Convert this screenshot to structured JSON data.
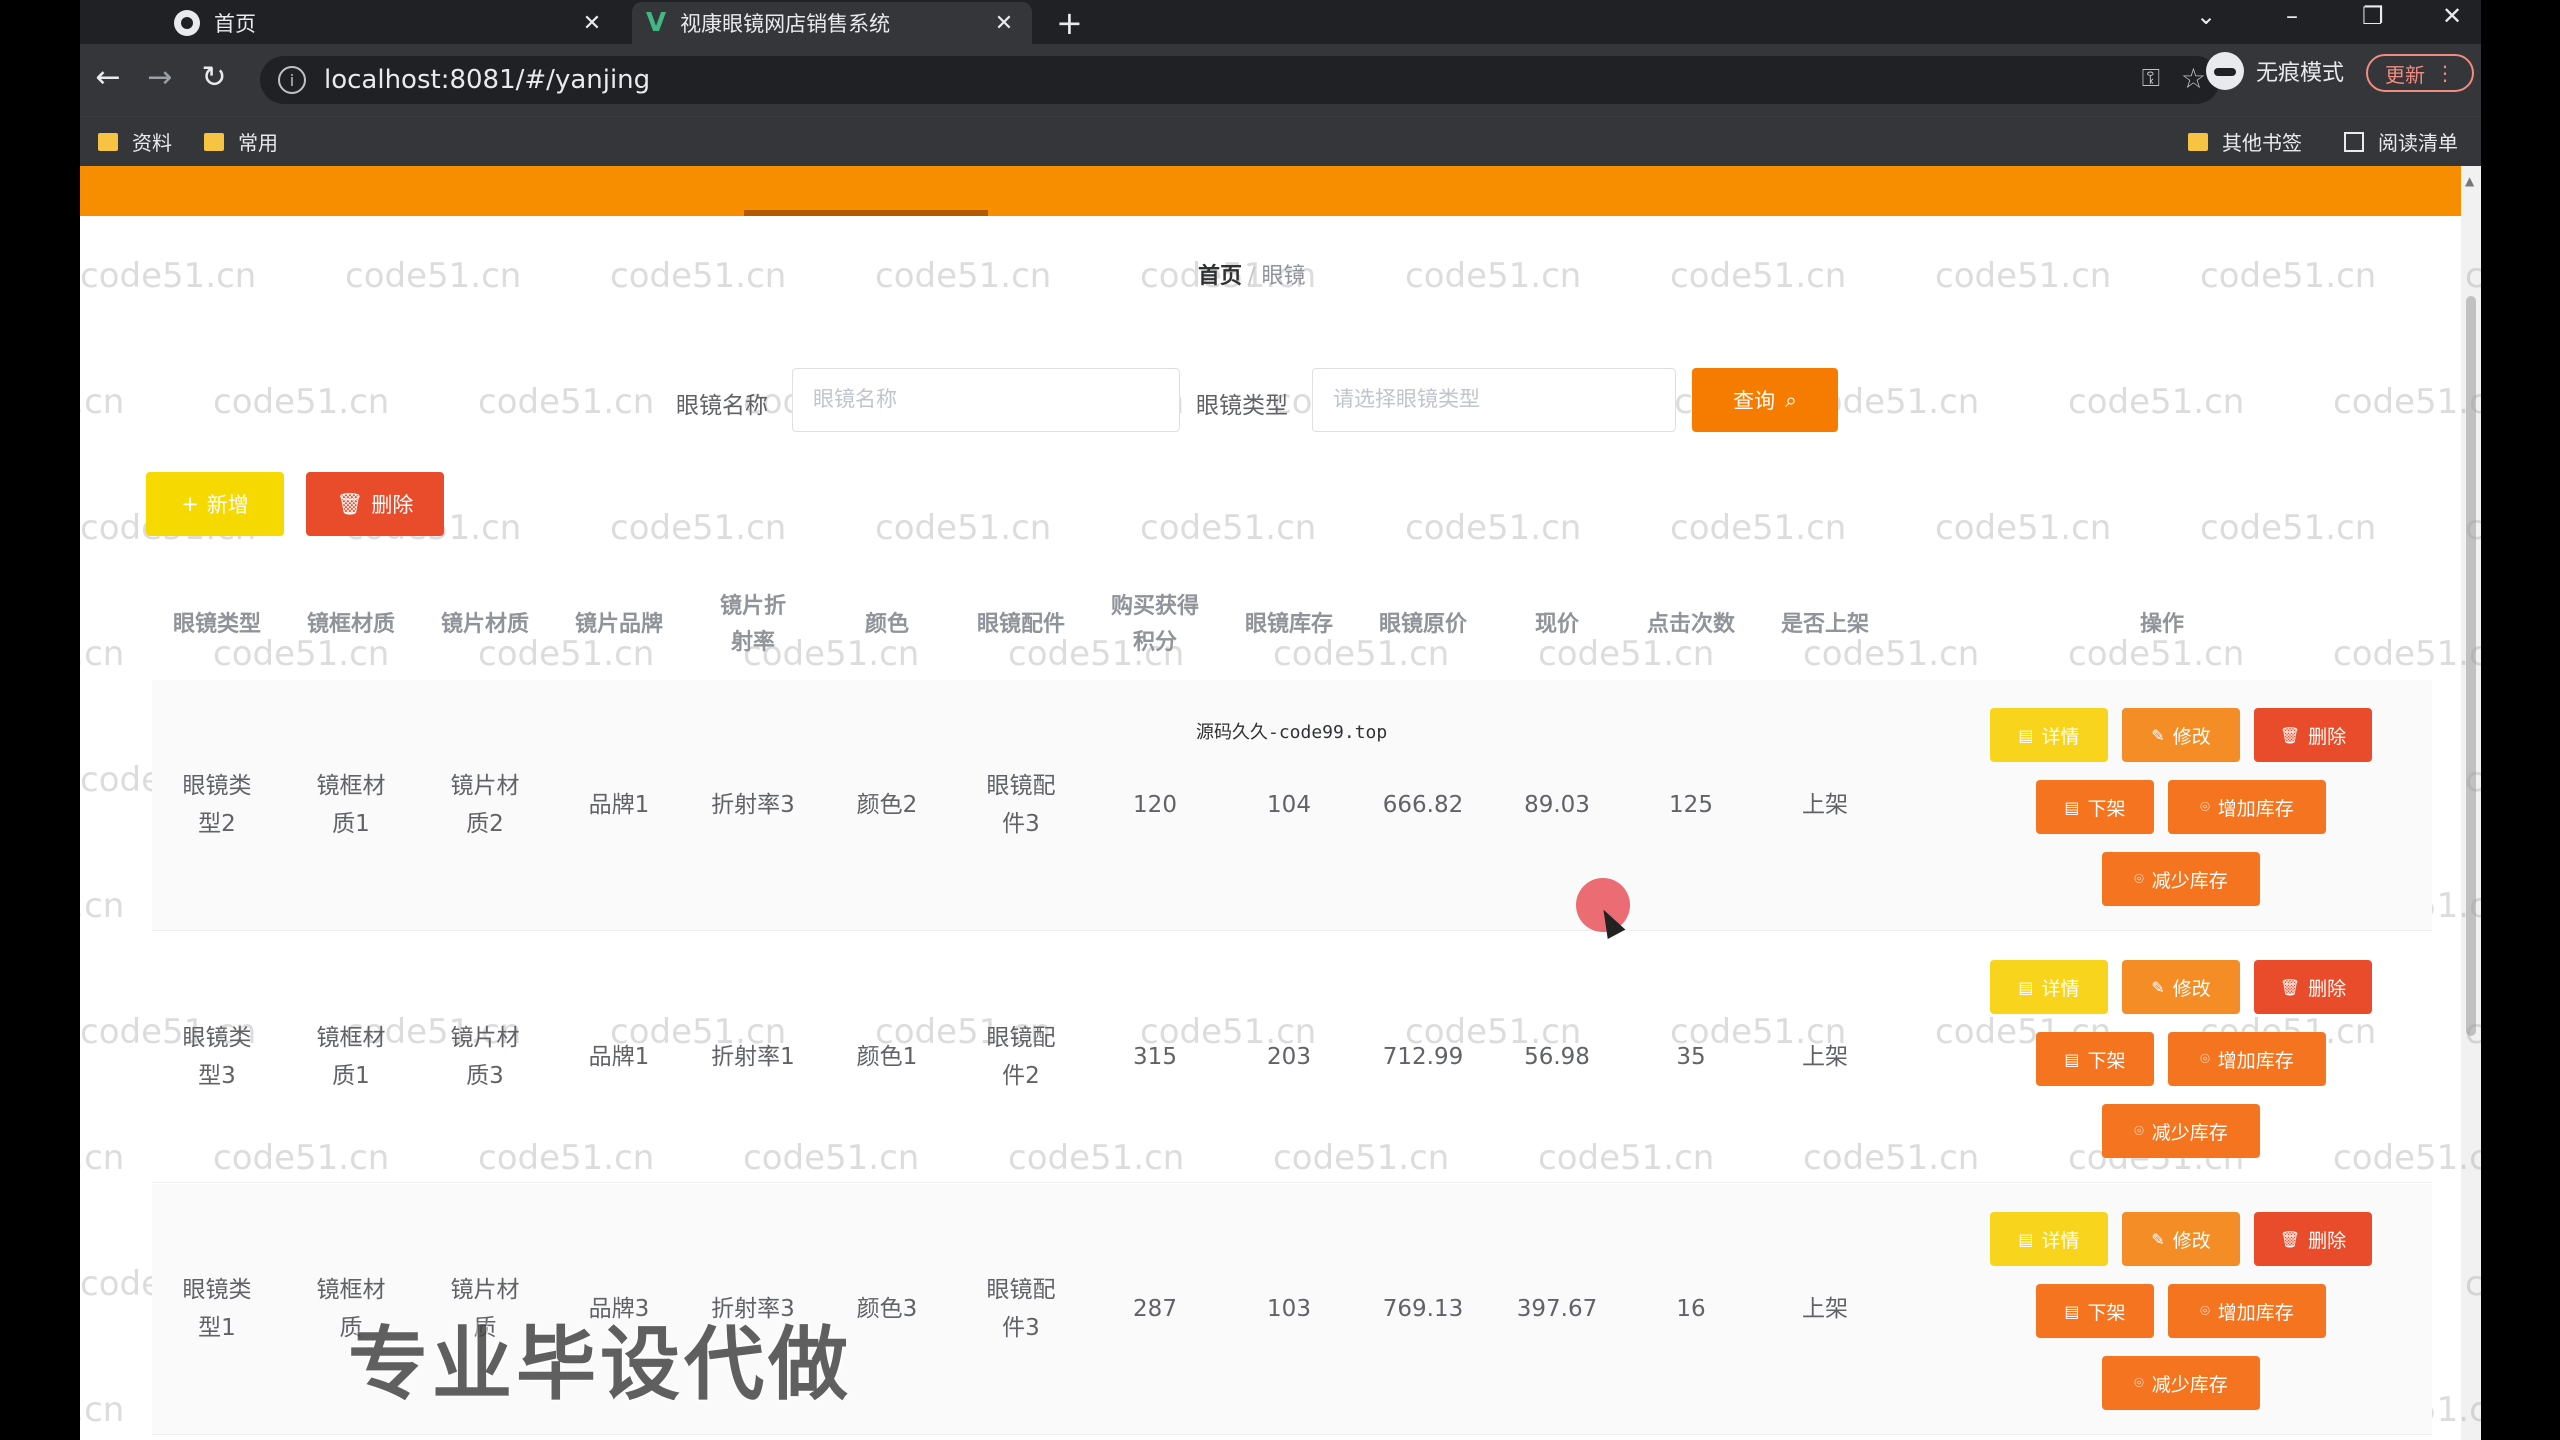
{
  "browser": {
    "tabs": [
      {
        "label": "首页",
        "active": false
      },
      {
        "label": "视康眼镜网店销售系统",
        "active": true
      }
    ],
    "url": "localhost:8081/#/yanjing",
    "incognito_label": "无痕模式",
    "update_label": "更新",
    "bookmarks_left": [
      "资料",
      "常用"
    ],
    "bookmarks_right": [
      "其他书签",
      "阅读清单"
    ]
  },
  "breadcrumb": {
    "home": "首页",
    "current": "眼镜"
  },
  "search": {
    "name_label": "眼镜名称",
    "name_placeholder": "眼镜名称",
    "type_label": "眼镜类型",
    "type_placeholder": "请选择眼镜类型",
    "query_label": "查询"
  },
  "toolbar": {
    "add_label": "新增",
    "delete_label": "删除"
  },
  "table": {
    "columns": [
      "眼镜类型",
      "镜框材质",
      "镜片材质",
      "镜片品牌",
      "镜片折射率",
      "颜色",
      "眼镜配件",
      "购买获得积分",
      "眼镜库存",
      "眼镜原价",
      "现价",
      "点击次数",
      "是否上架",
      "操作"
    ],
    "rows": [
      {
        "type": "眼镜类型2",
        "frame": "镜框材质1",
        "lens": "镜片材质2",
        "brand": "品牌1",
        "refraction": "折射率3",
        "color": "颜色2",
        "accessory": "眼镜配件3",
        "points": "120",
        "stock": "104",
        "original_price": "666.82",
        "price": "89.03",
        "clicks": "125",
        "on_shelf": "上架"
      },
      {
        "type": "眼镜类型3",
        "frame": "镜框材质1",
        "lens": "镜片材质3",
        "brand": "品牌1",
        "refraction": "折射率1",
        "color": "颜色1",
        "accessory": "眼镜配件2",
        "points": "315",
        "stock": "203",
        "original_price": "712.99",
        "price": "56.98",
        "clicks": "35",
        "on_shelf": "上架"
      },
      {
        "type": "眼镜类型1",
        "frame": "镜框材质",
        "lens": "镜片材质",
        "brand": "品牌3",
        "refraction": "折射率3",
        "color": "颜色3",
        "accessory": "眼镜配件3",
        "points": "287",
        "stock": "103",
        "original_price": "769.13",
        "price": "397.67",
        "clicks": "16",
        "on_shelf": "上架"
      }
    ],
    "actions": {
      "detail": "详情",
      "edit": "修改",
      "delete": "删除",
      "off_shelf": "下架",
      "stock_up": "增加库存",
      "stock_down": "减少库存"
    }
  },
  "overlay": {
    "watermark": "code51.cn",
    "center_mark": "源码久久-code99.top",
    "promo": "专业毕设代做"
  },
  "colors": {
    "accent": "#f78e00",
    "query_button": "#f57c00",
    "add_button": "#f5d900",
    "delete_button": "#e94c2a"
  }
}
